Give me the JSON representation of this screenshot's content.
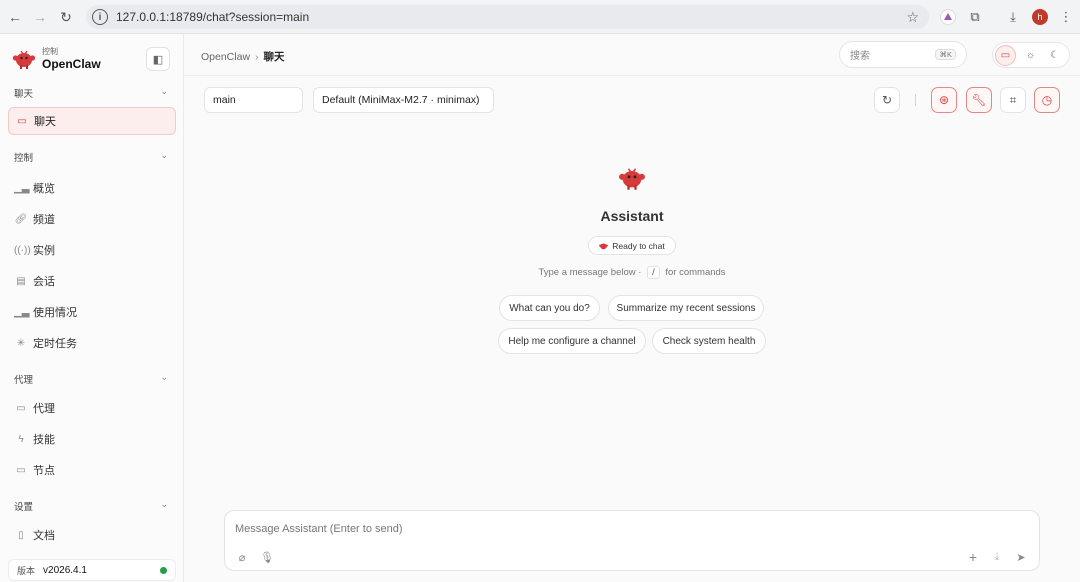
{
  "browser": {
    "url": "127.0.0.1:18789/chat?session=main",
    "profile_initial": "h"
  },
  "brand": {
    "subtitle": "控制",
    "name": "OpenClaw",
    "accent": "#d24343"
  },
  "sidebar": {
    "sections": [
      {
        "title": "聊天",
        "items": [
          {
            "label": "聊天",
            "icon": "chat-bubble-icon",
            "active": true
          }
        ]
      },
      {
        "title": "控制",
        "items": [
          {
            "label": "概览",
            "icon": "bar-chart-icon"
          },
          {
            "label": "频道",
            "icon": "link-icon"
          },
          {
            "label": "实例",
            "icon": "broadcast-icon"
          },
          {
            "label": "会话",
            "icon": "document-icon"
          },
          {
            "label": "使用情况",
            "icon": "bar-chart-icon"
          },
          {
            "label": "定时任务",
            "icon": "spinner-icon"
          }
        ]
      },
      {
        "title": "代理",
        "items": [
          {
            "label": "代理",
            "icon": "folder-icon"
          },
          {
            "label": "技能",
            "icon": "lightning-icon"
          },
          {
            "label": "节点",
            "icon": "monitor-icon"
          }
        ]
      },
      {
        "title": "设置",
        "items": [
          {
            "label": "文档",
            "icon": "book-icon"
          }
        ]
      }
    ],
    "version_label": "版本",
    "version_value": "v2026.4.1",
    "status_color": "#22a04a"
  },
  "topbar": {
    "breadcrumb_root": "OpenClaw",
    "breadcrumb_sep": "›",
    "breadcrumb_current": "聊天",
    "search_placeholder": "搜索",
    "search_shortcut": "⌘K"
  },
  "controls": {
    "session": "main",
    "model": "Default (MiniMax-M2.7 · minimax)"
  },
  "welcome": {
    "title": "Assistant",
    "status": "Ready to chat",
    "hint_before": "Type a message below ·",
    "hint_key": "/",
    "hint_after": "for commands",
    "suggestions": [
      "What can you do?",
      "Summarize my recent sessions",
      "Help me configure a channel",
      "Check system health"
    ]
  },
  "composer": {
    "placeholder": "Message Assistant (Enter to send)"
  }
}
